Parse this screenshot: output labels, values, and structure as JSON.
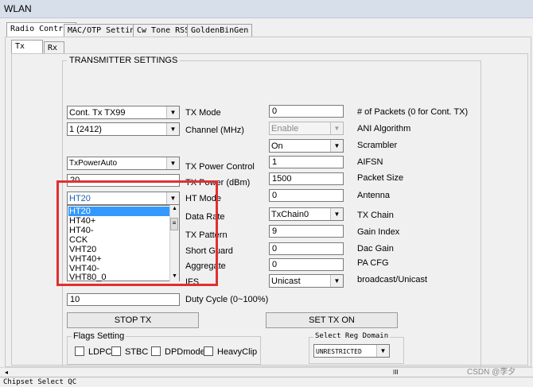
{
  "window": {
    "title": "WLAN"
  },
  "tabs": [
    "Radio Control",
    "MAC/OTP Settings",
    "Cw Tone RSSI",
    "GoldenBinGen"
  ],
  "subtabs": [
    "Tx",
    "Rx"
  ],
  "group_title": "TRANSMITTER SETTINGS",
  "left": {
    "tx_mode": "Cont. Tx TX99",
    "channel": "1 (2412)",
    "tx_power_control": "TxPowerAuto",
    "tx_power": "20",
    "ht_mode": "HT20",
    "duty_cycle": "10"
  },
  "ht_mode_options": [
    "HT20",
    "HT40+",
    "HT40-",
    "CCK",
    "VHT20",
    "VHT40+",
    "VHT40-",
    "VHT80_0"
  ],
  "left_labels": {
    "tx_mode": "TX Mode",
    "channel": "Channel (MHz)",
    "tx_power_control": "TX Power Control",
    "tx_power": "TX Power (dBm)",
    "ht_mode": "HT Mode",
    "data_rate": "Data Rate",
    "tx_pattern": "TX Pattern",
    "short_guard": "Short Guard",
    "aggregate": "Aggregate",
    "ifs": "IFS",
    "duty_cycle": "Duty Cycle (0~100%)"
  },
  "right": {
    "packets": "0",
    "ani_algorithm": "Enable",
    "scrambler": "On",
    "aifsn": "1",
    "packet_size": "1500",
    "antenna": "0",
    "tx_chain": "TxChain0",
    "gain_index": "9",
    "dac_gain": "0",
    "pa_cfg": "0",
    "broadcast": "Unicast"
  },
  "right_labels": {
    "packets": "# of Packets (0 for Cont. TX)",
    "ani_algorithm": "ANI Algorithm",
    "scrambler": "Scrambler",
    "aifsn": "AIFSN",
    "packet_size": "Packet Size",
    "antenna": "Antenna",
    "tx_chain": "TX Chain",
    "gain_index": "Gain Index",
    "dac_gain": "Dac Gain",
    "pa_cfg": "PA CFG",
    "broadcast": "broadcast/Unicast"
  },
  "buttons": {
    "stop_tx": "STOP TX",
    "set_tx_on": "SET TX ON"
  },
  "flags": {
    "title": "Flags Setting",
    "items": [
      "LDPC",
      "STBC",
      "DPDmode",
      "HeavyClip"
    ]
  },
  "reg_domain": {
    "title": "Select Reg Domain",
    "value": "UNRESTRICTED"
  },
  "status": {
    "text": "Chipset Select  QC",
    "watermark": "CSDN @李夕",
    "scroll_mark": "III"
  },
  "colors": {
    "highlight": "#e03030",
    "selection": "#3399ff",
    "titlebar": "#d6dfea"
  }
}
